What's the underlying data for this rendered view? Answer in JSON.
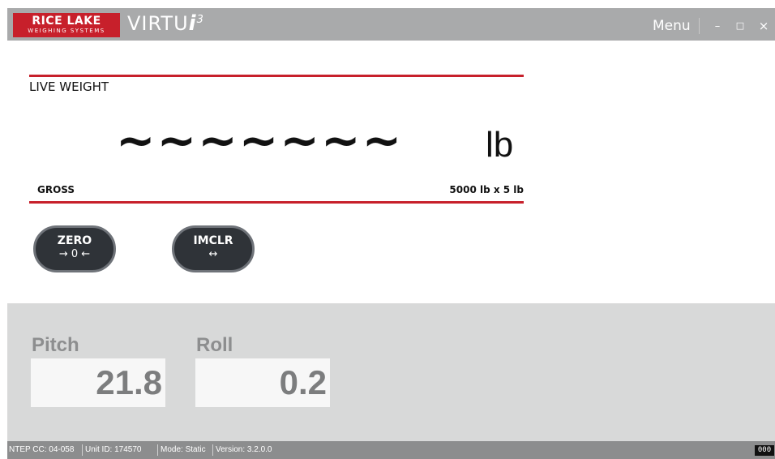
{
  "titlebar": {
    "logo_main": "RICE LAKE",
    "logo_sub": "WEIGHING SYSTEMS",
    "app_name": "VIRTU",
    "app_name_i": "i",
    "app_name_sup": "3",
    "menu_label": "Menu",
    "minimize_glyph": "–",
    "maximize_glyph": "□",
    "close_glyph": "×"
  },
  "scale": {
    "label": "LIVE WEIGHT",
    "value": "~~~~~~~",
    "unit": "lb",
    "mode": "GROSS",
    "capacity": "5000 lb x 5 lb"
  },
  "buttons": {
    "zero_label": "ZERO",
    "zero_symbol": "→ 0 ←",
    "imclr_label": "IMCLR",
    "imclr_symbol": "↔"
  },
  "readings": {
    "pitch_label": "Pitch",
    "pitch_value": "21.8",
    "roll_label": "Roll",
    "roll_value": "0.2"
  },
  "status": {
    "ntep": "NTEP CC: 04-058",
    "unit_id": "Unit ID: 174570",
    "mode": "Mode: Static",
    "version": "Version: 3.2.0.0",
    "badge": "000"
  },
  "colors": {
    "accent_red": "#c7202b",
    "titlebar": "#a9aaab",
    "button_bg": "#2f3338"
  }
}
